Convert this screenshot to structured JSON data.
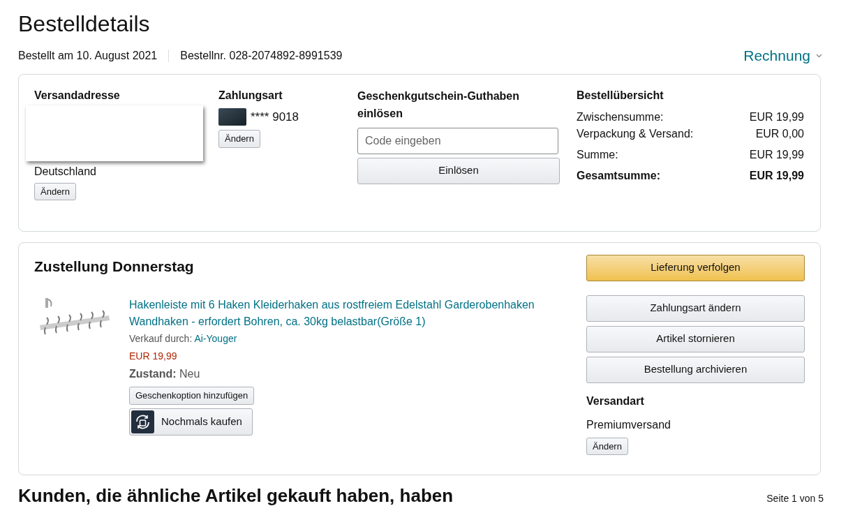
{
  "page_title": "Bestelldetails",
  "order_meta": {
    "date": "Bestellt am 10. August 2021",
    "number": "Bestellnr. 028-2074892-8991539",
    "invoice_link": "Rechnung"
  },
  "shipping_address": {
    "title": "Versandadresse",
    "country": "Deutschland",
    "change_button": "Ändern"
  },
  "payment": {
    "title": "Zahlungsart",
    "card": "**** 9018",
    "change_button": "Ändern"
  },
  "gift_card": {
    "title": "Geschenkgutschein-Guthaben einlösen",
    "placeholder": "Code eingeben",
    "redeem_button": "Einlösen"
  },
  "order_summary": {
    "title": "Bestellübersicht",
    "rows": [
      {
        "label": "Zwischensumme:",
        "value": "EUR 19,99",
        "bold": false
      },
      {
        "label": "Verpackung & Versand:",
        "value": "EUR 0,00",
        "bold": false
      },
      {
        "label": "Summe:",
        "value": "EUR 19,99",
        "bold": false
      },
      {
        "label": "Gesamtsumme:",
        "value": "EUR 19,99",
        "bold": true
      }
    ]
  },
  "delivery": {
    "title": "Zustellung Donnerstag",
    "item": {
      "title": "Hakenleiste mit 6 Haken Kleiderhaken aus rostfreiem Edelstahl Garderobenhaken Wandhaken - erfordert Bohren, ca. 30kg belastbar(Größe 1)",
      "seller_label": "Verkauf durch:",
      "seller": "Ai-Youger",
      "price": "EUR 19,99",
      "condition_label": "Zustand:",
      "condition": "Neu",
      "gift_button": "Geschenkoption hinzufügen",
      "buy_again_button": "Nochmals kaufen"
    },
    "actions": [
      {
        "label": "Lieferung verfolgen",
        "kind": "primary"
      },
      {
        "label": "Zahlungsart ändern",
        "kind": "secondary"
      },
      {
        "label": "Artikel stornieren",
        "kind": "secondary"
      },
      {
        "label": "Bestellung archivieren",
        "kind": "secondary"
      }
    ],
    "shipping_method": {
      "title": "Versandart",
      "value": "Premiumversand",
      "change_button": "Ändern"
    }
  },
  "recommendations": {
    "title": "Kunden, die ähnliche Artikel gekauft haben, haben",
    "pager": "Seite 1 von 5"
  }
}
